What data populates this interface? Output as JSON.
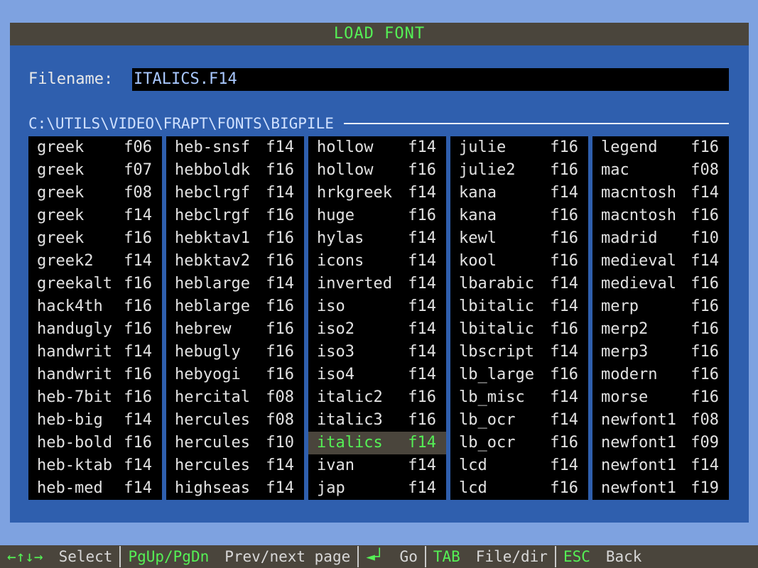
{
  "dialog": {
    "title": "LOAD FONT"
  },
  "filename": {
    "label": "Filename:",
    "value": "ITALICS.F14"
  },
  "path": "C:\\UTILS\\VIDEO\\FRAPT\\FONTS\\BIGPILE",
  "files": [
    [
      {
        "name": "greek",
        "ext": "f06"
      },
      {
        "name": "greek",
        "ext": "f07"
      },
      {
        "name": "greek",
        "ext": "f08"
      },
      {
        "name": "greek",
        "ext": "f14"
      },
      {
        "name": "greek",
        "ext": "f16"
      },
      {
        "name": "greek2",
        "ext": "f14"
      },
      {
        "name": "greekalt",
        "ext": "f16"
      },
      {
        "name": "hack4th",
        "ext": "f16"
      },
      {
        "name": "handugly",
        "ext": "f16"
      },
      {
        "name": "handwrit",
        "ext": "f14"
      },
      {
        "name": "handwrit",
        "ext": "f16"
      },
      {
        "name": "heb-7bit",
        "ext": "f16"
      },
      {
        "name": "heb-big",
        "ext": "f14"
      },
      {
        "name": "heb-bold",
        "ext": "f16"
      },
      {
        "name": "heb-ktab",
        "ext": "f14"
      },
      {
        "name": "heb-med",
        "ext": "f14"
      }
    ],
    [
      {
        "name": "heb-snsf",
        "ext": "f14"
      },
      {
        "name": "hebboldk",
        "ext": "f16"
      },
      {
        "name": "hebclrgf",
        "ext": "f14"
      },
      {
        "name": "hebclrgf",
        "ext": "f16"
      },
      {
        "name": "hebktav1",
        "ext": "f16"
      },
      {
        "name": "hebktav2",
        "ext": "f16"
      },
      {
        "name": "heblarge",
        "ext": "f14"
      },
      {
        "name": "heblarge",
        "ext": "f16"
      },
      {
        "name": "hebrew",
        "ext": "f16"
      },
      {
        "name": "hebugly",
        "ext": "f16"
      },
      {
        "name": "hebyogi",
        "ext": "f16"
      },
      {
        "name": "hercital",
        "ext": "f08"
      },
      {
        "name": "hercules",
        "ext": "f08"
      },
      {
        "name": "hercules",
        "ext": "f10"
      },
      {
        "name": "hercules",
        "ext": "f14"
      },
      {
        "name": "highseas",
        "ext": "f14"
      }
    ],
    [
      {
        "name": "hollow",
        "ext": "f14"
      },
      {
        "name": "hollow",
        "ext": "f16"
      },
      {
        "name": "hrkgreek",
        "ext": "f14"
      },
      {
        "name": "huge",
        "ext": "f16"
      },
      {
        "name": "hylas",
        "ext": "f14"
      },
      {
        "name": "icons",
        "ext": "f14"
      },
      {
        "name": "inverted",
        "ext": "f14"
      },
      {
        "name": "iso",
        "ext": "f14"
      },
      {
        "name": "iso2",
        "ext": "f14"
      },
      {
        "name": "iso3",
        "ext": "f14"
      },
      {
        "name": "iso4",
        "ext": "f14"
      },
      {
        "name": "italic2",
        "ext": "f16"
      },
      {
        "name": "italic3",
        "ext": "f16"
      },
      {
        "name": "italics",
        "ext": "f14",
        "selected": true
      },
      {
        "name": "ivan",
        "ext": "f14"
      },
      {
        "name": "jap",
        "ext": "f14"
      }
    ],
    [
      {
        "name": "julie",
        "ext": "f16"
      },
      {
        "name": "julie2",
        "ext": "f16"
      },
      {
        "name": "kana",
        "ext": "f14"
      },
      {
        "name": "kana",
        "ext": "f16"
      },
      {
        "name": "kewl",
        "ext": "f16"
      },
      {
        "name": "kool",
        "ext": "f16"
      },
      {
        "name": "lbarabic",
        "ext": "f14"
      },
      {
        "name": "lbitalic",
        "ext": "f14"
      },
      {
        "name": "lbitalic",
        "ext": "f16"
      },
      {
        "name": "lbscript",
        "ext": "f14"
      },
      {
        "name": "lb_large",
        "ext": "f16"
      },
      {
        "name": "lb_misc",
        "ext": "f14"
      },
      {
        "name": "lb_ocr",
        "ext": "f14"
      },
      {
        "name": "lb_ocr",
        "ext": "f16"
      },
      {
        "name": "lcd",
        "ext": "f14"
      },
      {
        "name": "lcd",
        "ext": "f16"
      }
    ],
    [
      {
        "name": "legend",
        "ext": "f16"
      },
      {
        "name": "mac",
        "ext": "f08"
      },
      {
        "name": "macntosh",
        "ext": "f14"
      },
      {
        "name": "macntosh",
        "ext": "f16"
      },
      {
        "name": "madrid",
        "ext": "f10"
      },
      {
        "name": "medieval",
        "ext": "f14"
      },
      {
        "name": "medieval",
        "ext": "f16"
      },
      {
        "name": "merp",
        "ext": "f16"
      },
      {
        "name": "merp2",
        "ext": "f16"
      },
      {
        "name": "merp3",
        "ext": "f16"
      },
      {
        "name": "modern",
        "ext": "f16"
      },
      {
        "name": "morse",
        "ext": "f16"
      },
      {
        "name": "newfont1",
        "ext": "f08"
      },
      {
        "name": "newfont1",
        "ext": "f09"
      },
      {
        "name": "newfont1",
        "ext": "f14"
      },
      {
        "name": "newfont1",
        "ext": "f19"
      }
    ]
  ],
  "statusbar": [
    {
      "key": "←↑↓→",
      "label": "Select",
      "icon": "arrow-keys-icon"
    },
    {
      "key": "PgUp/PgDn",
      "label": "Prev/next page"
    },
    {
      "key": "◄┘",
      "label": "Go",
      "icon": "enter-key-icon"
    },
    {
      "key": "TAB",
      "label": "File/dir"
    },
    {
      "key": "ESC",
      "label": "Back"
    }
  ],
  "colors": {
    "background": "#7ea2e0",
    "dialog": "#2f5fae",
    "titlebar": "#4a453c",
    "accent": "#55f055",
    "list_bg": "#000000",
    "selection": "#4a453c"
  }
}
